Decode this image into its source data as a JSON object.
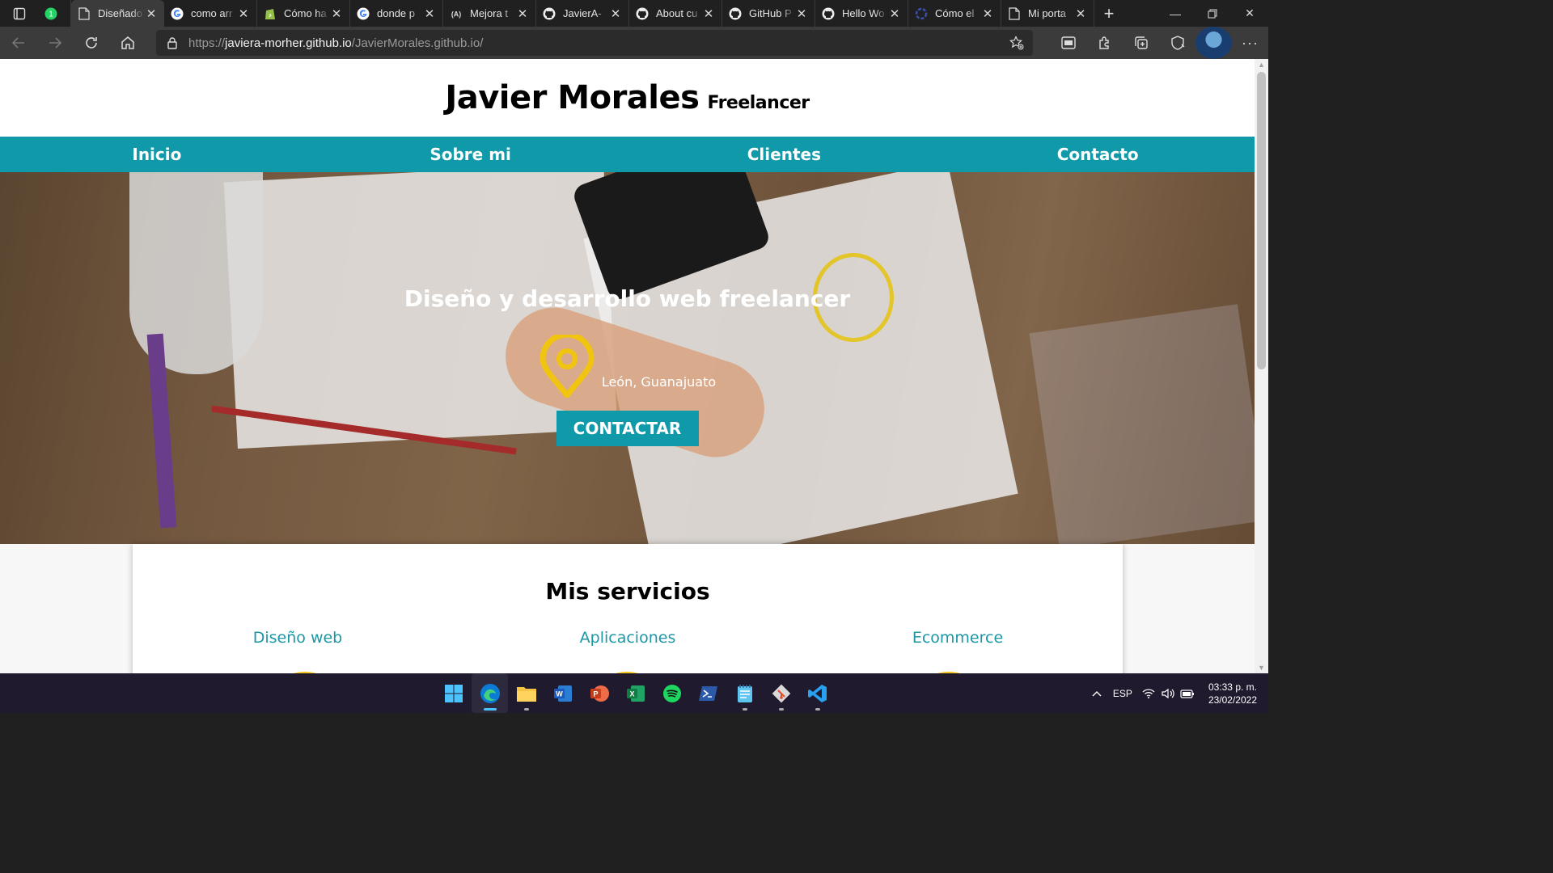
{
  "browser": {
    "tabs": [
      {
        "title": "",
        "icon": "whatsapp-icon",
        "pinned": true
      },
      {
        "title": "Diseñado",
        "icon": "page-icon",
        "active": true
      },
      {
        "title": "como arr",
        "icon": "google-icon"
      },
      {
        "title": "Cómo ha",
        "icon": "shopify-icon"
      },
      {
        "title": "donde p",
        "icon": "google-icon"
      },
      {
        "title": "Mejora t",
        "icon": "a11y-icon"
      },
      {
        "title": "JavierA-",
        "icon": "github-icon"
      },
      {
        "title": "About cu",
        "icon": "github-icon"
      },
      {
        "title": "GitHub P",
        "icon": "github-icon"
      },
      {
        "title": "Hello Wo",
        "icon": "github-icon"
      },
      {
        "title": "Cómo el",
        "icon": "spinner-icon"
      },
      {
        "title": "Mi porta",
        "icon": "page-icon"
      }
    ],
    "url_prefix": "https://",
    "url_host": "javiera-morher.github.io",
    "url_path": "/JavierMorales.github.io/"
  },
  "site": {
    "name": "Javier Morales",
    "tagline": "Freelancer",
    "nav": [
      "Inicio",
      "Sobre mi",
      "Clientes",
      "Contacto"
    ],
    "hero_title": "Diseño y desarrollo web freelancer",
    "location": "León, Guanajuato",
    "cta_label": "CONTACTAR",
    "services_title": "Mis servicios",
    "services": [
      "Diseño web",
      "Aplicaciones",
      "Ecommerce"
    ]
  },
  "colors": {
    "brand_teal": "#109aa9",
    "pin_yellow": "#f1c40f"
  },
  "taskbar": {
    "apps": [
      "windows-start-icon",
      "edge-icon",
      "file-explorer-icon",
      "word-icon",
      "powerpoint-icon",
      "excel-icon",
      "spotify-icon",
      "powershell-icon",
      "notepad-icon",
      "git-icon",
      "vscode-icon"
    ],
    "language": "ESP",
    "time": "03:33 p. m.",
    "date": "23/02/2022"
  }
}
